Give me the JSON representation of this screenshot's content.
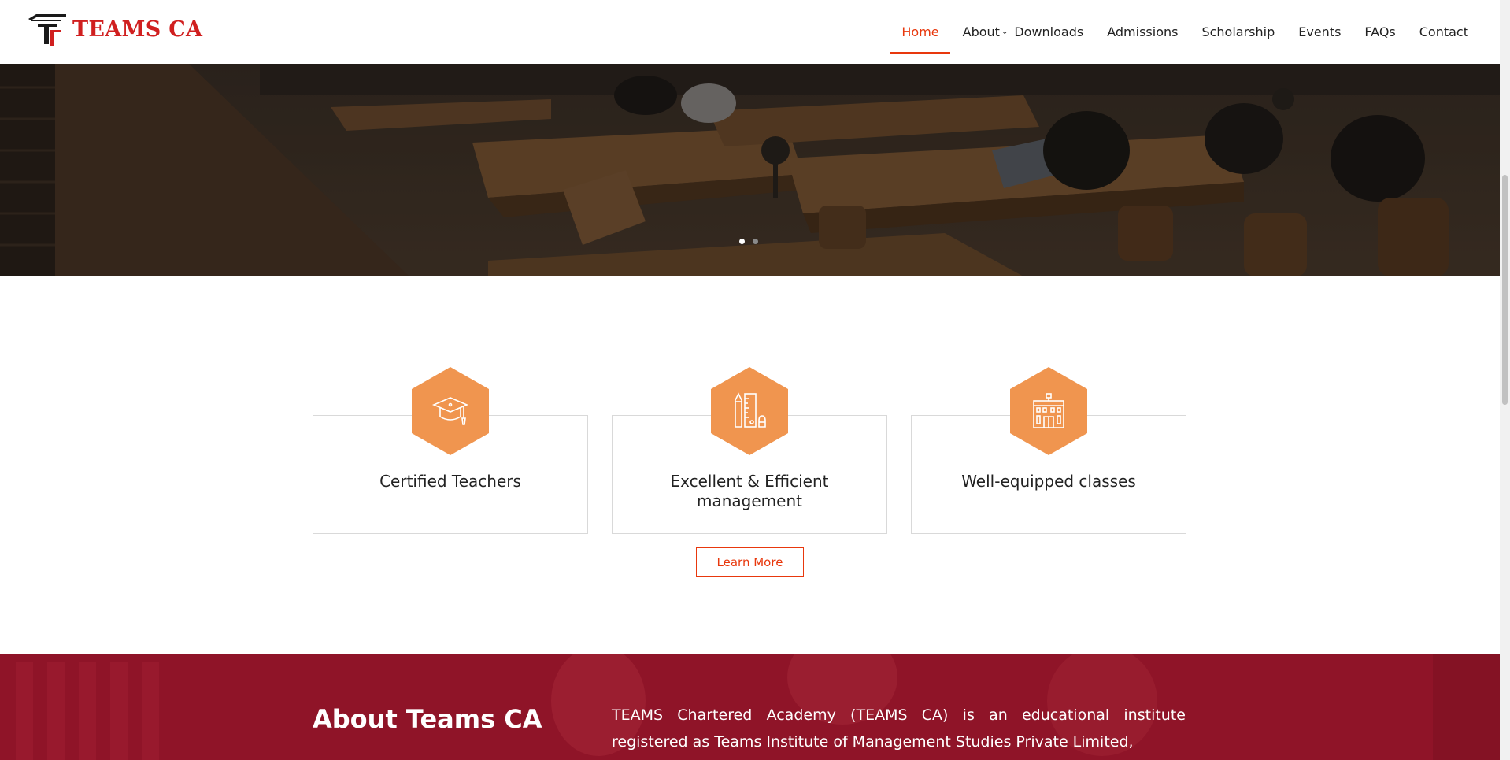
{
  "header": {
    "logo_text": "TEAMS CA",
    "nav": [
      {
        "label": "Home",
        "active": true
      },
      {
        "label": "About",
        "has_dropdown": true
      },
      {
        "label": "Downloads"
      },
      {
        "label": "Admissions"
      },
      {
        "label": "Scholarship"
      },
      {
        "label": "Events"
      },
      {
        "label": "FAQs"
      },
      {
        "label": "Contact"
      }
    ],
    "dropdown_icon": "chevron-down-icon"
  },
  "hero": {
    "image": "library reading room photo",
    "slides": 2,
    "active_slide": 1
  },
  "features": {
    "items": [
      {
        "title": "Certified Teachers",
        "icon": "graduation-cap-icon"
      },
      {
        "title": "Excellent & Efficient management",
        "icon": "ruler-pencil-icon"
      },
      {
        "title": "Well-equipped classes",
        "icon": "school-building-icon"
      }
    ],
    "button_label": "Learn More"
  },
  "about": {
    "title": "About Teams CA",
    "text": "TEAMS Chartered Academy (TEAMS CA) is an educational institute registered as Teams Institute of Management Studies Private Limited,"
  },
  "colors": {
    "accent": "#e8380d",
    "brand_red": "#d01f1f",
    "hex_orange": "#f0954f",
    "about_bg": "#8f1428"
  }
}
